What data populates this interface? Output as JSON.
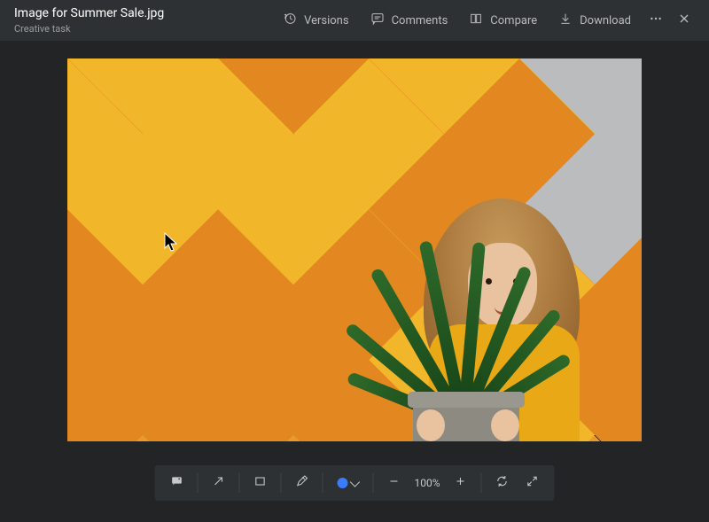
{
  "header": {
    "filename": "Image for Summer Sale.jpg",
    "subtitle": "Creative task",
    "actions": {
      "versions": "Versions",
      "comments": "Comments",
      "compare": "Compare",
      "download": "Download"
    }
  },
  "toolbar": {
    "zoom_level": "100%",
    "color": "#3a7bff"
  }
}
